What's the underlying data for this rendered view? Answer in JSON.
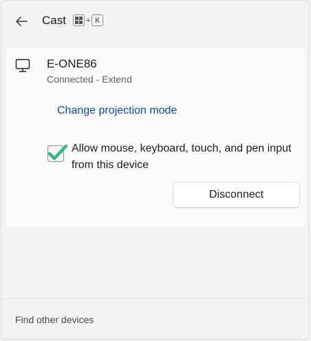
{
  "header": {
    "title": "Cast",
    "back_icon": "back-arrow-icon",
    "shortcut": {
      "win_key_icon": "windows-logo-icon",
      "plus": "+",
      "key": "K"
    }
  },
  "device": {
    "icon": "monitor-icon",
    "name": "E-ONE86",
    "status": "Connected - Extend",
    "change_link": "Change projection mode",
    "allow_input": {
      "checked": true,
      "label": "Allow mouse, keyboard, touch, and pen input from this device"
    },
    "disconnect_label": "Disconnect"
  },
  "footer": {
    "find_label": "Find other devices"
  },
  "colors": {
    "link": "#0a4a9e",
    "check": "#2bb58a"
  }
}
